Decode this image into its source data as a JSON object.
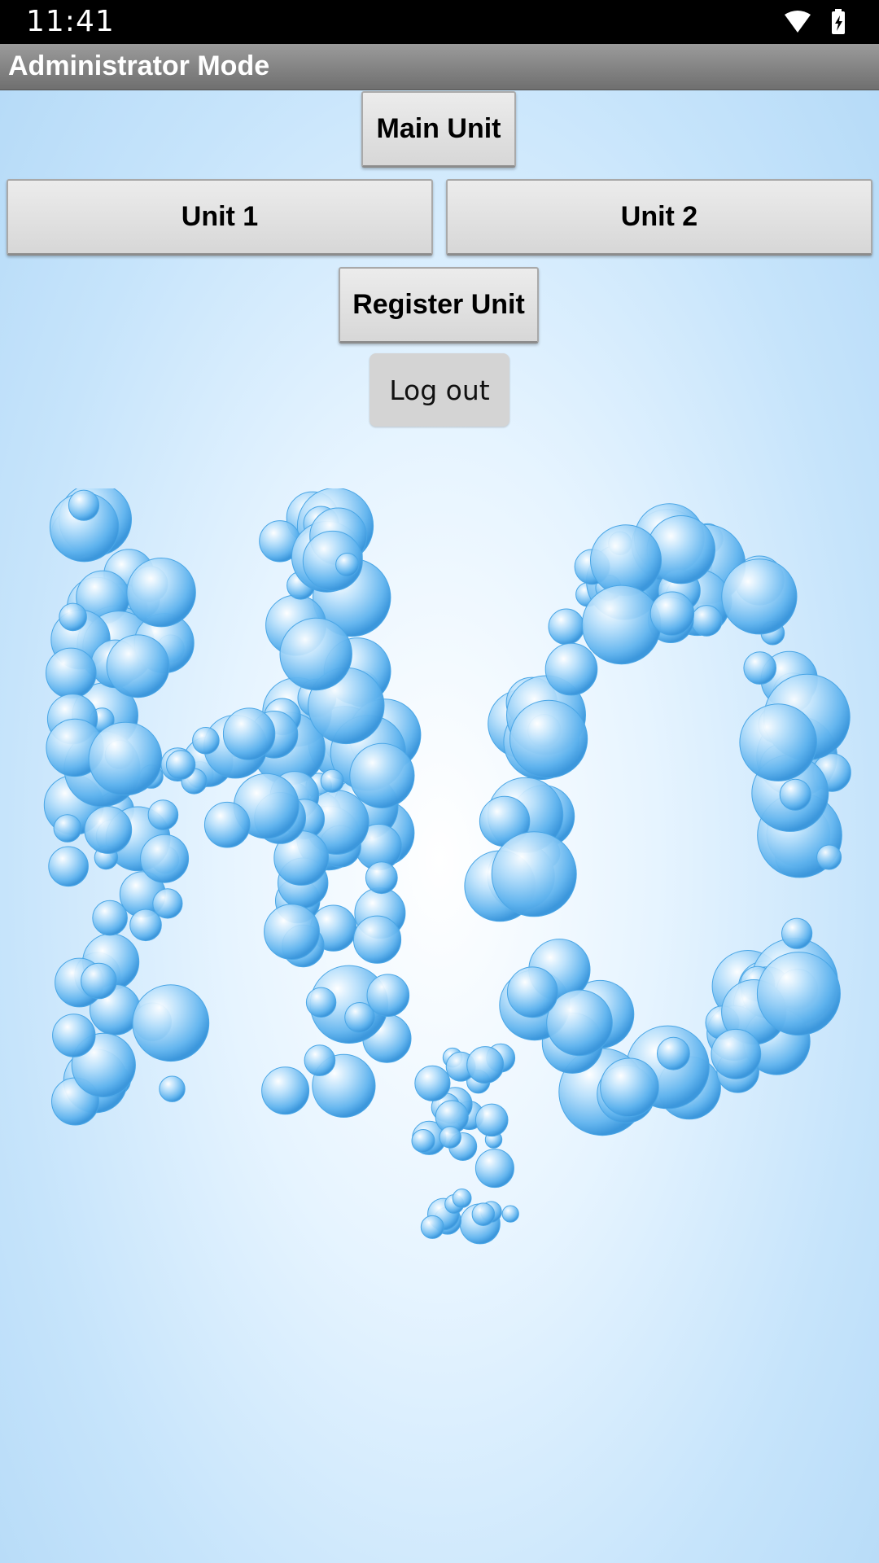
{
  "status_bar": {
    "time": "11:41",
    "icons": [
      "wifi-icon",
      "battery-charging-icon"
    ]
  },
  "app_bar": {
    "title": "Administrator Mode"
  },
  "buttons": {
    "main_unit": "Main Unit",
    "unit_1": "Unit 1",
    "unit_2": "Unit 2",
    "register_unit": "Register Unit",
    "log_out": "Log out"
  },
  "background": {
    "description_icon": "h2o-bubbles-art",
    "colors": {
      "sky_light": "#e6f4ff",
      "sky_edge": "#b3d9f7",
      "bubble": "#5fb3ee"
    }
  }
}
